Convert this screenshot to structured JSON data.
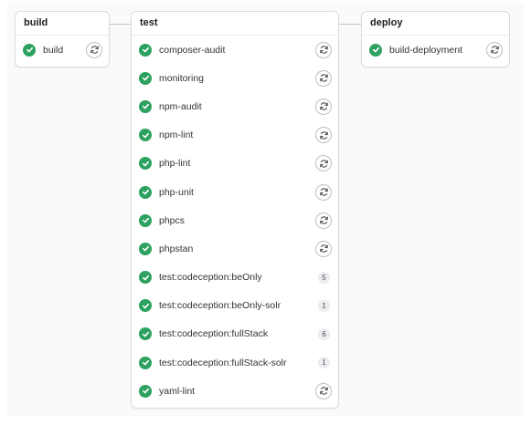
{
  "colors": {
    "success": "#2da160",
    "border": "#dcdcde",
    "connector": "#c6c6ca",
    "canvas": "#fafafa"
  },
  "stages": [
    {
      "title": "build",
      "jobs": [
        {
          "name": "build",
          "status": "success",
          "action": "retry"
        }
      ]
    },
    {
      "title": "test",
      "jobs": [
        {
          "name": "composer-audit",
          "status": "success",
          "action": "retry"
        },
        {
          "name": "monitoring",
          "status": "success",
          "action": "retry"
        },
        {
          "name": "npm-audit",
          "status": "success",
          "action": "retry"
        },
        {
          "name": "npm-lint",
          "status": "success",
          "action": "retry"
        },
        {
          "name": "php-lint",
          "status": "success",
          "action": "retry"
        },
        {
          "name": "php-unit",
          "status": "success",
          "action": "retry"
        },
        {
          "name": "phpcs",
          "status": "success",
          "action": "retry"
        },
        {
          "name": "phpstan",
          "status": "success",
          "action": "retry"
        },
        {
          "name": "test:codeception:beOnly",
          "status": "success",
          "count": "5"
        },
        {
          "name": "test:codeception:beOnly-solr",
          "status": "success",
          "count": "1"
        },
        {
          "name": "test:codeception:fullStack",
          "status": "success",
          "count": "6"
        },
        {
          "name": "test:codeception:fullStack-solr",
          "status": "success",
          "count": "1"
        },
        {
          "name": "yaml-lint",
          "status": "success",
          "action": "retry"
        }
      ]
    },
    {
      "title": "deploy",
      "jobs": [
        {
          "name": "build-deployment",
          "status": "success",
          "action": "retry"
        }
      ]
    }
  ]
}
